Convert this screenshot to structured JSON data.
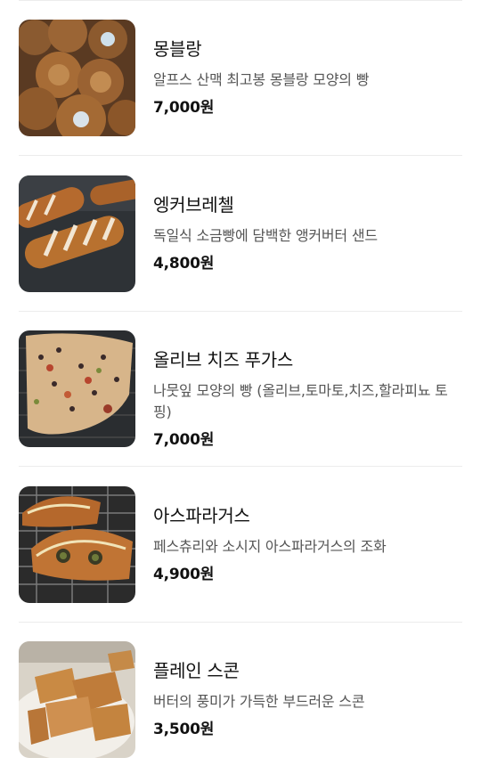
{
  "menu": {
    "items": [
      {
        "name": "몽블랑",
        "description": "알프스 산맥 최고봉 몽블랑 모양의 빵",
        "price": "7,000원",
        "image": "mont-blanc-pastry-photo"
      },
      {
        "name": "엥커브레첼",
        "description": "독일식 소금빵에 담백한 앵커버터 샌드",
        "price": "4,800원",
        "image": "anchor-pretzel-photo"
      },
      {
        "name": "올리브 치즈 푸가스",
        "description": "나뭇잎 모양의 빵 (올리브,토마토,치즈,할라피뇨 토핑)",
        "price": "7,000원",
        "image": "olive-cheese-fougasse-photo"
      },
      {
        "name": "아스파라거스",
        "description": "페스츄리와 소시지 아스파라거스의 조화",
        "price": "4,900원",
        "image": "asparagus-pastry-photo"
      },
      {
        "name": "플레인 스콘",
        "description": "버터의 풍미가 가득한 부드러운 스콘",
        "price": "3,500원",
        "image": "plain-scone-photo"
      }
    ]
  }
}
